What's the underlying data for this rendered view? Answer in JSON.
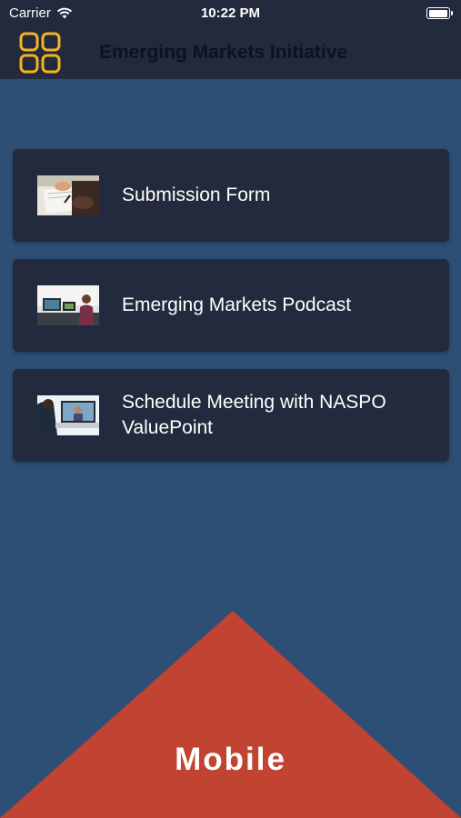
{
  "status": {
    "carrier": "Carrier",
    "time": "10:22 PM",
    "battery_level": 1.0
  },
  "navbar": {
    "title": "Emerging Markets Initiative",
    "menu_icon": "grid-icon",
    "accent": "#f5b321"
  },
  "items": [
    {
      "label": "Submission Form",
      "thumb": "document-signing-photo"
    },
    {
      "label": "Emerging Markets Podcast",
      "thumb": "podcast-studio-photo"
    },
    {
      "label": "Schedule Meeting with NASPO ValuePoint",
      "thumb": "video-meeting-photo"
    }
  ],
  "footer": {
    "label": "Mobile",
    "color": "#c14331"
  },
  "colors": {
    "background": "#2d4e75",
    "bar": "#232a3d",
    "card": "#232a3d"
  }
}
